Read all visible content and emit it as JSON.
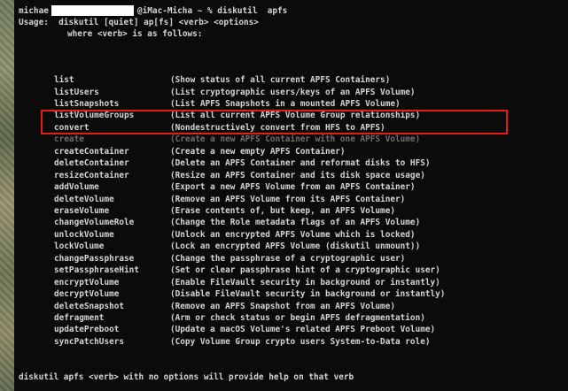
{
  "terminal": {
    "prompt_user": "michae",
    "prompt_host": "@iMac-Micha ~ % diskutil  apfs",
    "usage": "Usage:  diskutil [quiet] ap[fs] <verb> <options>",
    "where": "where <verb> is as follows:",
    "commands": [
      {
        "name": "list",
        "desc": "(Show status of all current APFS Containers)"
      },
      {
        "name": "listUsers",
        "desc": "(List cryptographic users/keys of an APFS Volume)"
      },
      {
        "name": "listSnapshots",
        "desc": "(List APFS Snapshots in a mounted APFS Volume)"
      },
      {
        "name": "listVolumeGroups",
        "desc": "(List all current APFS Volume Group relationships)"
      },
      {
        "name": "convert",
        "desc": "(Nondestructively convert from HFS to APFS)"
      },
      {
        "name": "create",
        "desc": "(Create a new APFS Container with one APFS Volume)"
      },
      {
        "name": "createContainer",
        "desc": "(Create a new empty APFS Container)"
      },
      {
        "name": "deleteContainer",
        "desc": "(Delete an APFS Container and reformat disks to HFS)"
      },
      {
        "name": "resizeContainer",
        "desc": "(Resize an APFS Container and its disk space usage)"
      },
      {
        "name": "addVolume",
        "desc": "(Export a new APFS Volume from an APFS Container)"
      },
      {
        "name": "deleteVolume",
        "desc": "(Remove an APFS Volume from its APFS Container)"
      },
      {
        "name": "eraseVolume",
        "desc": "(Erase contents of, but keep, an APFS Volume)"
      },
      {
        "name": "changeVolumeRole",
        "desc": "(Change the Role metadata flags of an APFS Volume)"
      },
      {
        "name": "unlockVolume",
        "desc": "(Unlock an encrypted APFS Volume which is locked)"
      },
      {
        "name": "lockVolume",
        "desc": "(Lock an encrypted APFS Volume (diskutil unmount))"
      },
      {
        "name": "changePassphrase",
        "desc": "(Change the passphrase of a cryptographic user)"
      },
      {
        "name": "setPassphraseHint",
        "desc": "(Set or clear passphrase hint of a cryptographic user)"
      },
      {
        "name": "encryptVolume",
        "desc": "(Enable FileVault security in background or instantly)"
      },
      {
        "name": "decryptVolume",
        "desc": "(Disable FileVault security in background or instantly)"
      },
      {
        "name": "deleteSnapshot",
        "desc": "(Remove an APFS Snapshot from an APFS Volume)"
      },
      {
        "name": "defragment",
        "desc": "(Arm or check status or begin APFS defragmentation)"
      },
      {
        "name": "updatePreboot",
        "desc": "(Update a macOS Volume's related APFS Preboot Volume)"
      },
      {
        "name": "syncPatchUsers",
        "desc": "(Copy Volume Group crypto users System-to-Data role)"
      }
    ],
    "footer": "diskutil apfs <verb> with no options will provide help on that verb"
  },
  "colors": {
    "terminal_background": "#0b0b0b",
    "terminal_text": "#d4d4d4",
    "highlight_border": "#e41e12",
    "redaction": "#ffffff"
  }
}
